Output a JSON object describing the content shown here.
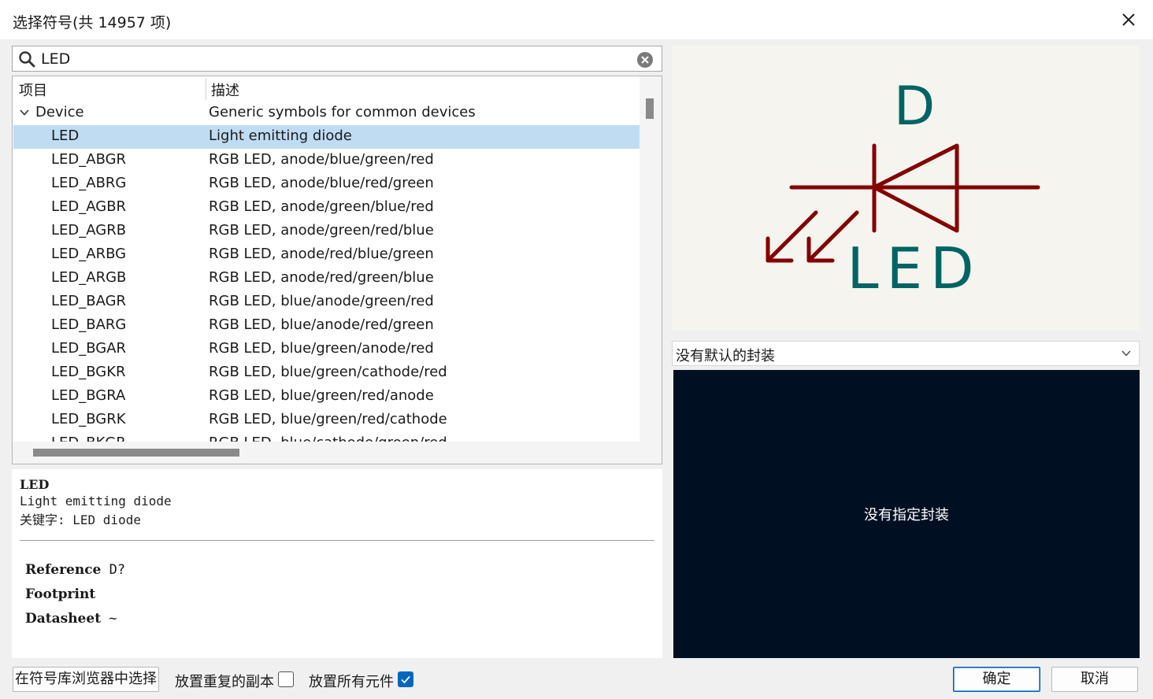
{
  "window": {
    "title": "选择符号(共 14957 项)"
  },
  "search": {
    "value": "LED"
  },
  "tree": {
    "columns": [
      "项目",
      "描述"
    ],
    "group": {
      "name": "Device",
      "description": "Generic symbols for common devices"
    },
    "items": [
      {
        "name": "LED",
        "description": "Light emitting diode",
        "selected": true
      },
      {
        "name": "LED_ABGR",
        "description": "RGB LED, anode/blue/green/red"
      },
      {
        "name": "LED_ABRG",
        "description": "RGB LED, anode/blue/red/green"
      },
      {
        "name": "LED_AGBR",
        "description": "RGB LED, anode/green/blue/red"
      },
      {
        "name": "LED_AGRB",
        "description": "RGB LED, anode/green/red/blue"
      },
      {
        "name": "LED_ARBG",
        "description": "RGB LED, anode/red/blue/green"
      },
      {
        "name": "LED_ARGB",
        "description": "RGB LED, anode/red/green/blue"
      },
      {
        "name": "LED_BAGR",
        "description": "RGB LED, blue/anode/green/red"
      },
      {
        "name": "LED_BARG",
        "description": "RGB LED, blue/anode/red/green"
      },
      {
        "name": "LED_BGAR",
        "description": "RGB LED, blue/green/anode/red"
      },
      {
        "name": "LED_BGKR",
        "description": "RGB LED, blue/green/cathode/red"
      },
      {
        "name": "LED_BGRA",
        "description": "RGB LED, blue/green/red/anode"
      },
      {
        "name": "LED_BGRK",
        "description": "RGB LED, blue/green/red/cathode"
      },
      {
        "name": "LED_BKGR",
        "description": "RGB LED, blue/cathode/green/red"
      }
    ]
  },
  "details": {
    "name": "LED",
    "description": "Light emitting diode",
    "keywords": "关键字: LED diode",
    "fields": [
      {
        "label": "Reference",
        "value": "D?"
      },
      {
        "label": "Footprint",
        "value": ""
      },
      {
        "label": "Datasheet",
        "value": "~"
      }
    ]
  },
  "symbol_preview": {
    "reference": "D",
    "value": "LED",
    "colors": {
      "body": "#840000",
      "text": "#006464",
      "background": "#f5f4ef"
    }
  },
  "footprint": {
    "selected": "没有默认的封装",
    "preview_message": "没有指定封装"
  },
  "bottom": {
    "browse_label": "在符号库浏览器中选择",
    "place_duplicate_label": "放置重复的副本",
    "place_duplicate_checked": false,
    "place_all_label": "放置所有元件",
    "place_all_checked": true,
    "ok_label": "确定",
    "cancel_label": "取消"
  }
}
